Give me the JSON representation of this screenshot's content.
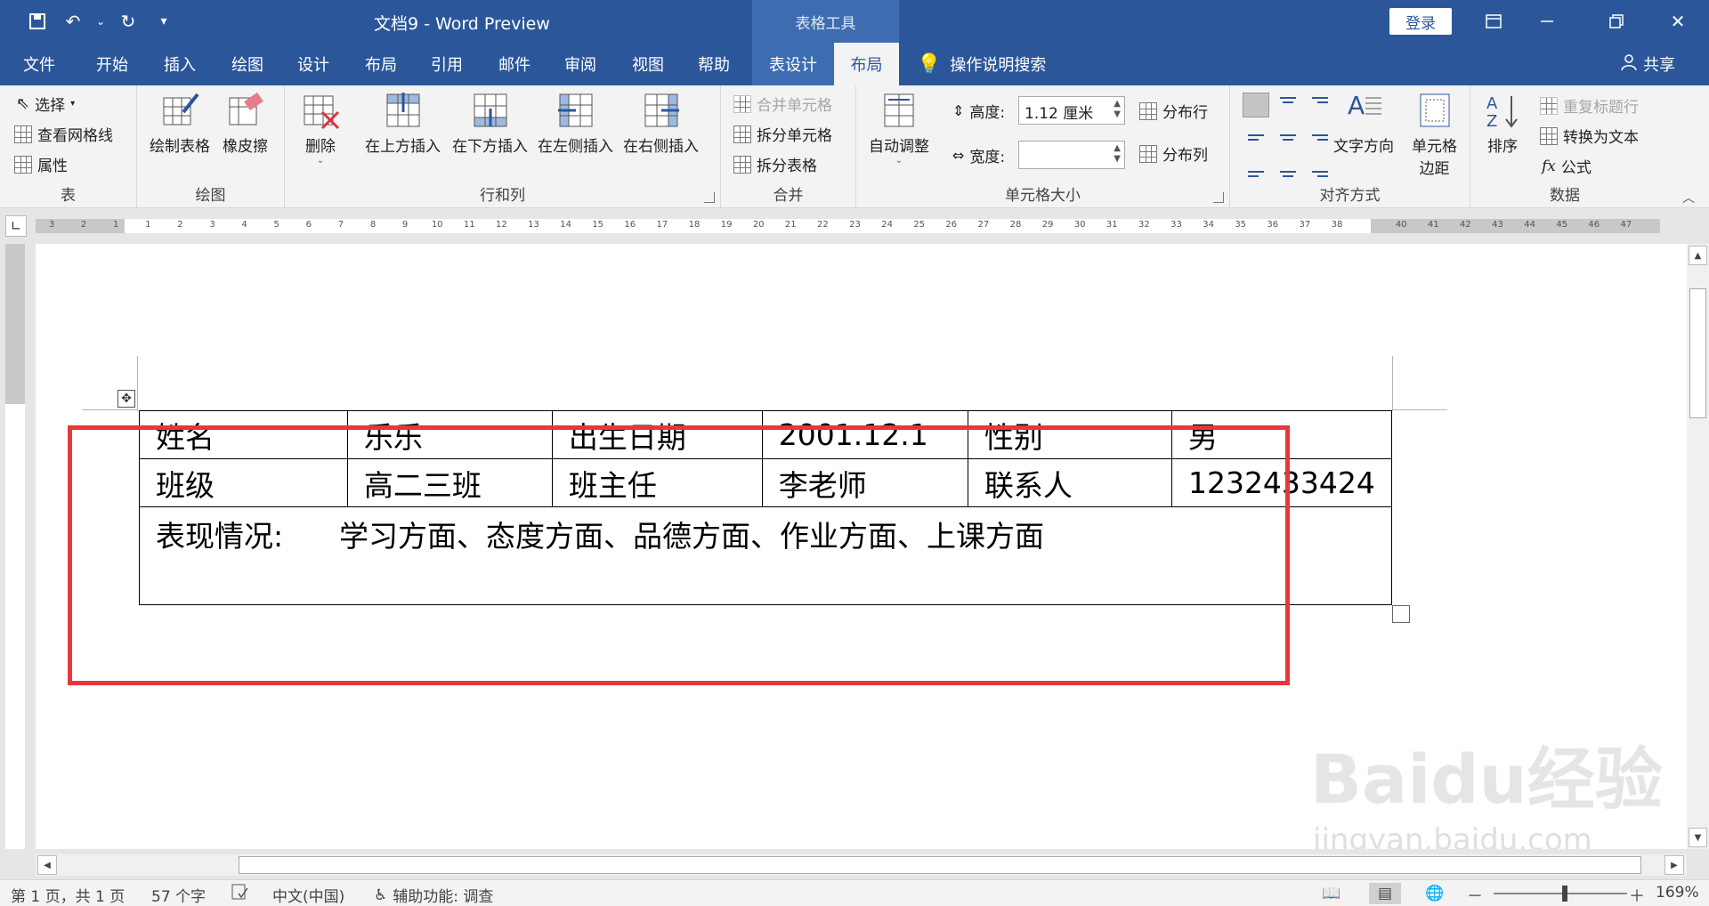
{
  "titlebar": {
    "doc_title": "文档9  -  Word Preview",
    "context_group": "表格工具",
    "login": "登录",
    "qat_dropdown": "⌄"
  },
  "tabs": [
    {
      "label": "文件"
    },
    {
      "label": "开始"
    },
    {
      "label": "插入"
    },
    {
      "label": "绘图"
    },
    {
      "label": "设计"
    },
    {
      "label": "布局"
    },
    {
      "label": "引用"
    },
    {
      "label": "邮件"
    },
    {
      "label": "审阅"
    },
    {
      "label": "视图"
    },
    {
      "label": "帮助"
    },
    {
      "label": "表设计"
    },
    {
      "label": "布局"
    }
  ],
  "search": {
    "label": "操作说明搜索"
  },
  "share": {
    "label": "共享"
  },
  "ribbon": {
    "table_group": {
      "select": "选择",
      "view_gridlines": "查看网格线",
      "properties": "属性",
      "label": "表"
    },
    "draw_group": {
      "draw_table": "绘制表格",
      "eraser": "橡皮擦",
      "label": "绘图"
    },
    "rows_cols_group": {
      "delete": "删除",
      "insert_above": "在上方插入",
      "insert_below": "在下方插入",
      "insert_left": "在左侧插入",
      "insert_right": "在右侧插入",
      "label": "行和列"
    },
    "merge_group": {
      "merge_cells": "合并单元格",
      "split_cells": "拆分单元格",
      "split_table": "拆分表格",
      "label": "合并"
    },
    "cell_size_group": {
      "autofit": "自动调整",
      "height_label": "高度:",
      "height_value": "1.12 厘米",
      "width_label": "宽度:",
      "width_value": "",
      "distribute_rows": "分布行",
      "distribute_cols": "分布列",
      "label": "单元格大小"
    },
    "alignment_group": {
      "text_direction": "文字方向",
      "cell_margins_1": "单元格",
      "cell_margins_2": "边距",
      "label": "对齐方式"
    },
    "data_group": {
      "sort": "排序",
      "repeat_header": "重复标题行",
      "convert_to_text": "转换为文本",
      "formula": "公式",
      "label": "数据"
    }
  },
  "ruler": {
    "numbers": [
      "3",
      "2",
      "1",
      "1",
      "2",
      "3",
      "4",
      "5",
      "6",
      "7",
      "8",
      "9",
      "10",
      "11",
      "12",
      "13",
      "14",
      "15",
      "16",
      "17",
      "18",
      "19",
      "20",
      "21",
      "22",
      "23",
      "24",
      "25",
      "26",
      "27",
      "28",
      "29",
      "30",
      "31",
      "32",
      "33",
      "34",
      "35",
      "36",
      "37",
      "38",
      "40",
      "41",
      "42",
      "43",
      "44",
      "45",
      "46",
      "47"
    ]
  },
  "document": {
    "table": {
      "rows": [
        [
          "姓名",
          "乐乐",
          "出生日期",
          "2001.12.1",
          "性别",
          "男"
        ],
        [
          "班级",
          "高二三班",
          "班主任",
          "李老师",
          "联系人",
          "1232433424"
        ]
      ],
      "remarks": "表现情况:      学习方面、态度方面、品德方面、作业方面、上课方面"
    },
    "watermark": "Baidu经验",
    "watermark_url": "jingyan.baidu.com"
  },
  "statusbar": {
    "page": "第 1 页，共 1 页",
    "words": "57 个字",
    "language": "中文(中国)",
    "accessibility": "辅助功能: 调查",
    "zoom": "169%",
    "zoom_minus": "－",
    "zoom_plus": "＋"
  },
  "colors": {
    "accent": "#2b579a",
    "highlight": "#e8373a"
  }
}
